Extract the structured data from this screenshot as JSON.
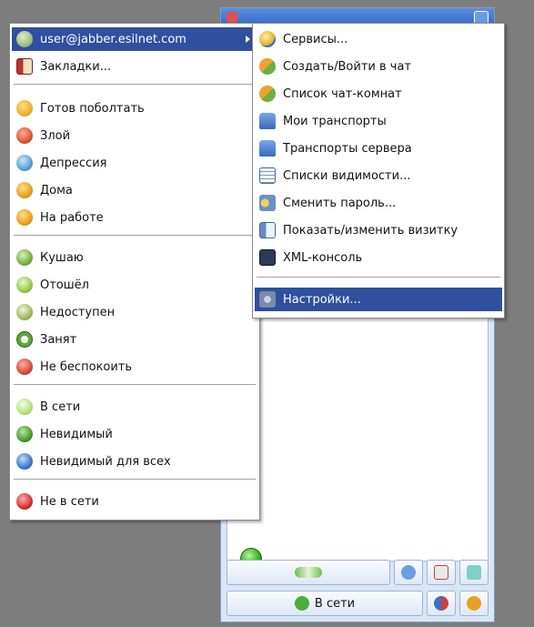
{
  "main_menu": {
    "account_label": "user@jabber.esilnet.com",
    "bookmarks_label": "Закладки...",
    "status_items": [
      {
        "label": "Готов поболтать",
        "icon": "chat-smile-icon",
        "color": "#f0b030"
      },
      {
        "label": "Злой",
        "icon": "angry-smile-icon",
        "color": "#e2543a"
      },
      {
        "label": "Депрессия",
        "icon": "depressed-smile-icon",
        "color": "#5aa0d6"
      },
      {
        "label": "Дома",
        "icon": "home-status-icon",
        "color": "#e8a020"
      },
      {
        "label": "На работе",
        "icon": "work-status-icon",
        "color": "#e8a020"
      }
    ],
    "away_items": [
      {
        "label": "Кушаю",
        "icon": "eating-status-icon",
        "color": "#7ab04a"
      },
      {
        "label": "Отошёл",
        "icon": "away-status-icon",
        "color": "#9ac850"
      },
      {
        "label": "Недоступен",
        "icon": "na-status-icon",
        "color": "#a0b860"
      },
      {
        "label": "Занят",
        "icon": "busy-clock-icon",
        "color": "#5ea83a"
      },
      {
        "label": "Не беспокоить",
        "icon": "dnd-status-icon",
        "color": "#d84a3a"
      }
    ],
    "online_items": [
      {
        "label": "В сети",
        "icon": "online-status-icon",
        "color": "#b8e080"
      },
      {
        "label": "Невидимый",
        "icon": "invisible-status-icon",
        "color": "#4a9a30"
      },
      {
        "label": "Невидимый для всех",
        "icon": "invisible-all-status-icon",
        "color": "#3a7acc"
      }
    ],
    "offline_label": "Не в сети"
  },
  "sub_menu": {
    "items": [
      {
        "label": "Сервисы...",
        "icon": "services-icon"
      },
      {
        "label": "Создать/Войти в чат",
        "icon": "create-chat-icon"
      },
      {
        "label": "Список чат-комнат",
        "icon": "chatroom-list-icon"
      },
      {
        "label": "Мои транспорты",
        "icon": "my-transports-icon"
      },
      {
        "label": "Транспорты сервера",
        "icon": "server-transports-icon"
      },
      {
        "label": "Списки видимости...",
        "icon": "visibility-lists-icon"
      },
      {
        "label": "Сменить пароль...",
        "icon": "change-password-icon"
      },
      {
        "label": "Показать/изменить визитку",
        "icon": "vcard-icon"
      },
      {
        "label": "XML-консоль",
        "icon": "xml-console-icon"
      }
    ],
    "settings_label": "Настройки..."
  },
  "app": {
    "status_button_label": "В сети"
  },
  "colors": {
    "highlight": "#2f4f9f",
    "menu_bg": "#ffffff",
    "desktop_bg": "#7d7d7d"
  }
}
